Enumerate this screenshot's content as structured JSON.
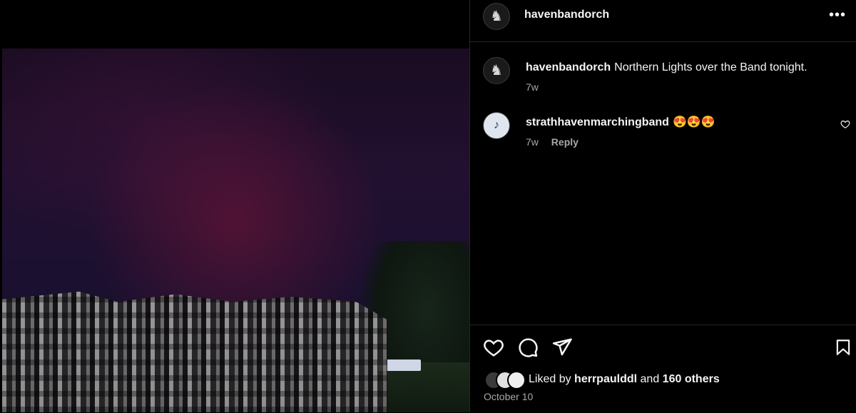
{
  "post": {
    "author": "havenbandorch",
    "more_icon": "more-horizontal-icon"
  },
  "caption": {
    "username": "havenbandorch",
    "text": "Northern Lights over the Band tonight.",
    "time": "7w"
  },
  "comments": [
    {
      "username": "strathhavenmarchingband",
      "text": "😍😍😍",
      "time": "7w",
      "reply_label": "Reply"
    }
  ],
  "actions": {
    "like_icon": "heart-icon",
    "comment_icon": "comment-icon",
    "share_icon": "send-icon",
    "save_icon": "bookmark-icon"
  },
  "likes": {
    "prefix": "Liked by",
    "user": "herrpaulddl",
    "connector": "and",
    "others": "160 others"
  },
  "date": "October 10",
  "colors": {
    "background": "#000000",
    "text": "#f5f5f5",
    "muted": "#a8a8a8",
    "divider": "#262626"
  }
}
